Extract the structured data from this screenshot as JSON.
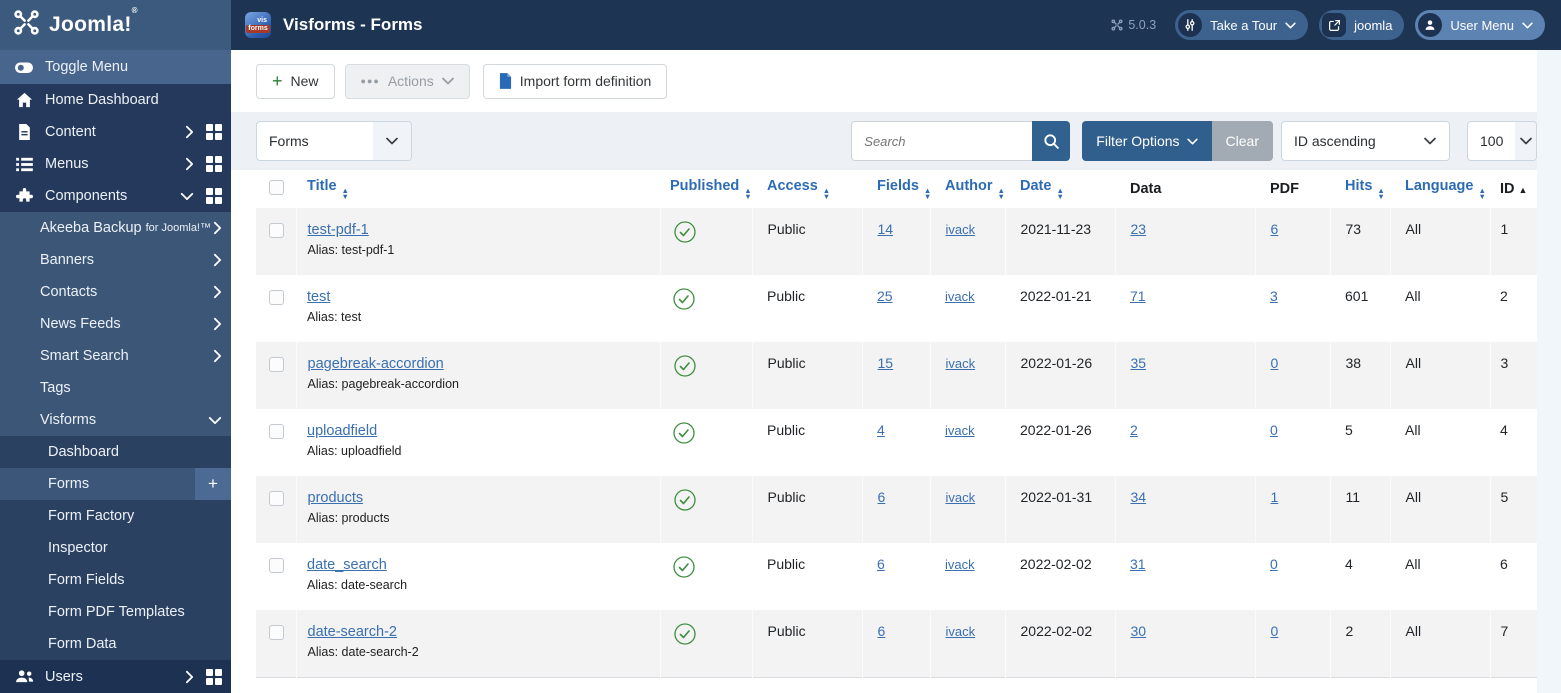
{
  "colors": {
    "topbar_bg": "#1e3453",
    "logo_area_bg": "#3c5a7e",
    "sidebar_bg": "#24395b",
    "submenu_bg": "#3b5677",
    "submenu2_bg": "#2b4162",
    "active_item_bg": "#3b5679",
    "filter_btn_bg": "#315f8d",
    "clear_btn_bg": "#a2aab3",
    "link_blue": "#3a6fb0",
    "header_link_blue": "#2d6cb5",
    "success_green": "#3e8e41",
    "stripe": "#f3f3f3"
  },
  "topbar": {
    "logo": "Joomla!",
    "logo_reg": "®",
    "app_icon_line1": "vis",
    "app_icon_line2": "forms",
    "title": "Visforms - Forms",
    "version": "5.0.3",
    "tour_pill": "Take a Tour",
    "site_pill": "joomla",
    "user_pill": "User Menu"
  },
  "sidebar": {
    "toggle_label": "Toggle Menu",
    "plus_label": "+",
    "items": [
      {
        "label": "Home Dashboard"
      },
      {
        "label": "Content"
      },
      {
        "label": "Menus"
      },
      {
        "label": "Components"
      },
      {
        "label": "Akeeba Backup",
        "suffix": "for Joomla!™"
      },
      {
        "label": "Banners"
      },
      {
        "label": "Contacts"
      },
      {
        "label": "News Feeds"
      },
      {
        "label": "Smart Search"
      },
      {
        "label": "Tags"
      },
      {
        "label": "Visforms"
      },
      {
        "label": "Dashboard"
      },
      {
        "label": "Forms"
      },
      {
        "label": "Form Factory"
      },
      {
        "label": "Inspector"
      },
      {
        "label": "Form Fields"
      },
      {
        "label": "Form PDF Templates"
      },
      {
        "label": "Form Data"
      },
      {
        "label": "Users"
      }
    ]
  },
  "toolbar": {
    "new_label": "New",
    "actions_label": "Actions",
    "import_label": "Import form definition"
  },
  "filters": {
    "category_value": "Forms",
    "search_placeholder": "Search",
    "filter_options_label": "Filter Options",
    "clear_label": "Clear",
    "sort_value": "ID ascending",
    "limit_value": "100"
  },
  "table": {
    "headers": {
      "title": "Title",
      "published": "Published",
      "access": "Access",
      "fields": "Fields",
      "author": "Author",
      "date": "Date",
      "data": "Data",
      "pdf": "PDF",
      "hits": "Hits",
      "language": "Language",
      "id": "ID"
    },
    "rows": [
      {
        "title": "test-pdf-1",
        "alias": "Alias: test-pdf-1",
        "access": "Public",
        "fields": "14",
        "author": "ivack",
        "date": "2021-11-23",
        "data": "23",
        "pdf": "6",
        "hits": "73",
        "language": "All",
        "id": "1"
      },
      {
        "title": "test",
        "alias": "Alias: test",
        "access": "Public",
        "fields": "25",
        "author": "ivack",
        "date": "2022-01-21",
        "data": "71",
        "pdf": "3",
        "hits": "601",
        "language": "All",
        "id": "2"
      },
      {
        "title": "pagebreak-accordion",
        "alias": "Alias: pagebreak-accordion",
        "access": "Public",
        "fields": "15",
        "author": "ivack",
        "date": "2022-01-26",
        "data": "35",
        "pdf": "0",
        "hits": "38",
        "language": "All",
        "id": "3"
      },
      {
        "title": "uploadfield",
        "alias": "Alias: uploadfield",
        "access": "Public",
        "fields": "4",
        "author": "ivack",
        "date": "2022-01-26",
        "data": "2",
        "pdf": "0",
        "hits": "5",
        "language": "All",
        "id": "4"
      },
      {
        "title": "products",
        "alias": "Alias: products",
        "access": "Public",
        "fields": "6",
        "author": "ivack",
        "date": "2022-01-31",
        "data": "34",
        "pdf": "1",
        "hits": "11",
        "language": "All",
        "id": "5"
      },
      {
        "title": "date_search",
        "alias": "Alias: date-search",
        "access": "Public",
        "fields": "6",
        "author": "ivack",
        "date": "2022-02-02",
        "data": "31",
        "pdf": "0",
        "hits": "4",
        "language": "All",
        "id": "6"
      },
      {
        "title": "date-search-2",
        "alias": "Alias: date-search-2",
        "access": "Public",
        "fields": "6",
        "author": "ivack",
        "date": "2022-02-02",
        "data": "30",
        "pdf": "0",
        "hits": "2",
        "language": "All",
        "id": "7"
      }
    ]
  }
}
